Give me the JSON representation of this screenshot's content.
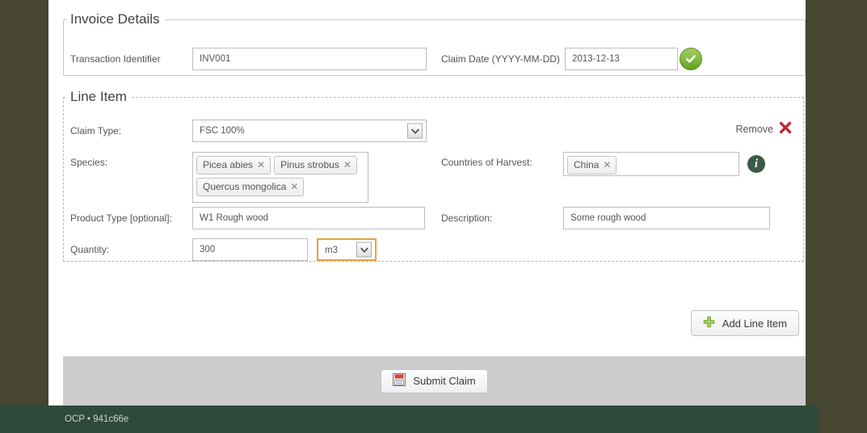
{
  "invoice_details": {
    "legend": "Invoice Details",
    "transaction_identifier": {
      "label": "Transaction Identifier",
      "value": "INV001"
    },
    "claim_date": {
      "label": "Claim Date (YYYY-MM-DD)",
      "value": "2013-12-13",
      "valid_icon": "check-circle-icon"
    }
  },
  "line_item": {
    "legend": "Line Item",
    "remove": {
      "label": "Remove",
      "icon": "red-x-icon"
    },
    "claim_type": {
      "label": "Claim Type:",
      "value": "FSC 100%"
    },
    "species": {
      "label": "Species:",
      "tags": [
        "Picea abies",
        "Pinus strobus",
        "Quercus mongolica"
      ]
    },
    "countries_of_harvest": {
      "label": "Countries of Harvest:",
      "tags": [
        "China"
      ],
      "info_icon": "info-icon"
    },
    "product_type": {
      "label": "Product Type [optional]:",
      "value": "W1 Rough wood"
    },
    "description": {
      "label": "Description:",
      "value": "Some rough wood"
    },
    "quantity": {
      "label": "Quantity:",
      "value": "300",
      "unit": "m3"
    }
  },
  "actions": {
    "add_line_item": {
      "label": "Add Line Item",
      "icon": "green-plus-icon"
    },
    "submit_claim": {
      "label": "Submit Claim",
      "icon": "save-floppy-icon"
    }
  },
  "footer": {
    "text": "OCP • 941c66e"
  },
  "colors": {
    "page_background": "#464631",
    "footer_background": "#2f4a3a",
    "submit_bar_background": "#cccccc",
    "focus_border": "#e3a43b",
    "remove_icon": "#c0272d",
    "valid_icon": "#62a023",
    "info_icon": "#3c5a47"
  }
}
